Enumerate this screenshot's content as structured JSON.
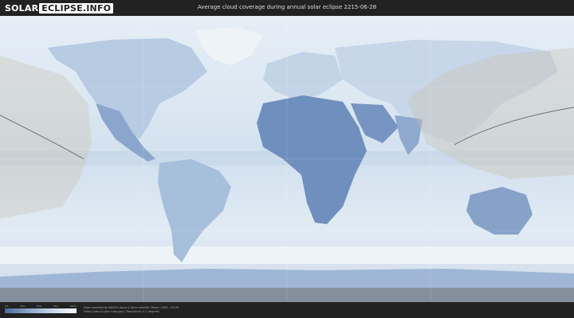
{
  "header": {
    "logo_solar": "SOLAR",
    "logo_eclipse": "ECLIPSE.INFO",
    "title": "Average cloud coverage during annual solar eclipse 2215-06-28"
  },
  "legend": {
    "ticks": [
      "0%",
      "25%",
      "50%",
      "75%",
      "100%"
    ],
    "gradient_colors": [
      "#4a6a9c",
      "#8aa6c8",
      "#c6d6e8",
      "#ffffff"
    ]
  },
  "credit": {
    "line1": "Data provided by NASA's Aqua & Terra satellite (Years: 2000 - 2019)",
    "line2": "https://neo.sci.gsfc.nasa.gov | Resolution: 0.1 degrees"
  },
  "colors": {
    "ocean_cloud": "#dde9f3",
    "clear_land": "#6f8fbf",
    "eclipse_band": "#c9bfae"
  }
}
